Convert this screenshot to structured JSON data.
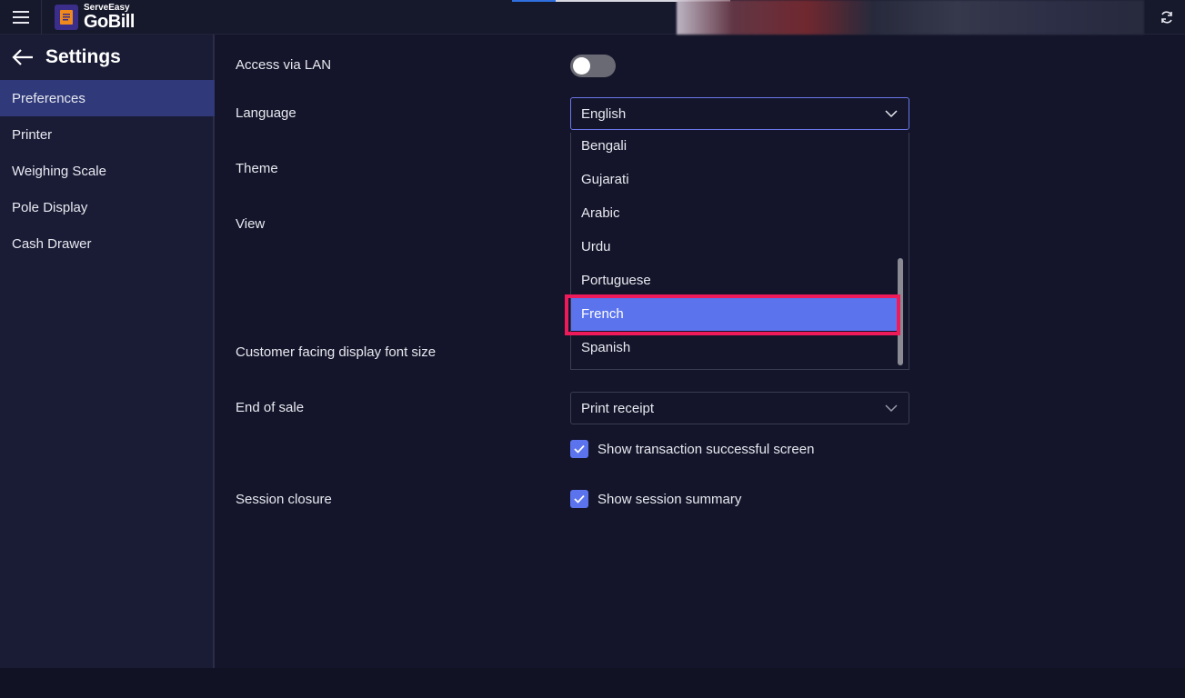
{
  "app": {
    "brand_small": "ServeEasy",
    "brand_big": "GoBill"
  },
  "sidebar": {
    "title": "Settings",
    "items": [
      {
        "label": "Preferences",
        "active": true
      },
      {
        "label": "Printer"
      },
      {
        "label": "Weighing Scale"
      },
      {
        "label": "Pole Display"
      },
      {
        "label": "Cash Drawer"
      }
    ]
  },
  "settings": {
    "access_lan_label": "Access via LAN",
    "access_lan_enabled": false,
    "language_label": "Language",
    "language_value": "English",
    "theme_label": "Theme",
    "view_label": "View",
    "font_size_label": "Customer facing display font size",
    "end_of_sale_label": "End of sale",
    "end_of_sale_value": "Print receipt",
    "show_txn_label": "Show transaction successful screen",
    "show_txn_checked": true,
    "session_closure_label": "Session closure",
    "show_summary_label": "Show session summary",
    "show_summary_checked": true
  },
  "language_dropdown": {
    "options": [
      "Bengali",
      "Gujarati",
      "Arabic",
      "Urdu",
      "Portuguese",
      "French",
      "Spanish"
    ],
    "selected": "French"
  },
  "colors": {
    "accent": "#5b74ee",
    "highlight": "#ee1a5a",
    "sidebar_active": "#303a7a"
  },
  "icons": {
    "menu": "hamburger-icon",
    "refresh": "refresh-icon",
    "back": "arrow-left-icon",
    "chevron": "chevron-down-icon",
    "check": "check-icon"
  }
}
